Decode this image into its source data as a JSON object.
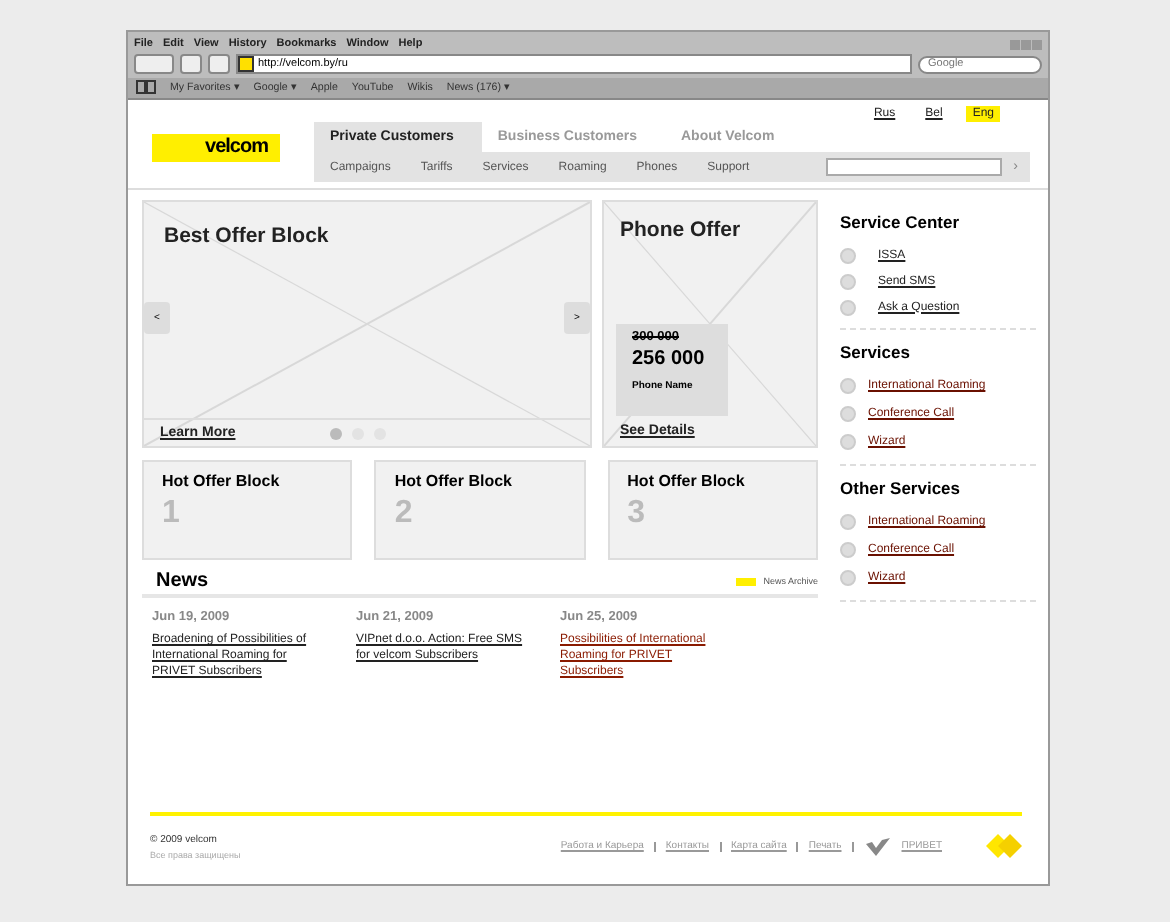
{
  "browser": {
    "menu": [
      "File",
      "Edit",
      "View",
      "History",
      "Bookmarks",
      "Window",
      "Help"
    ],
    "address": "http://velcom.by/ru",
    "search": {
      "placeholder": "Google"
    },
    "bookmarks": [
      "My Favorites ▾",
      "Google ▾",
      "Apple",
      "YouTube",
      "Wikis",
      "News (176) ▾"
    ]
  },
  "languages": [
    {
      "label": "Rus",
      "selected": false
    },
    {
      "label": "Bel",
      "selected": false
    },
    {
      "label": "Eng",
      "selected": true
    }
  ],
  "logo": "velcom",
  "tabs": [
    {
      "label": "Private Customers",
      "selected": true
    },
    {
      "label": "Business Customers",
      "selected": false
    },
    {
      "label": "About Velcom",
      "selected": false
    }
  ],
  "subnav": [
    "Campaigns",
    "Tariffs",
    "Services",
    "Roaming",
    "Phones",
    "Support"
  ],
  "subnav_search": {
    "button": "›"
  },
  "best_offer": {
    "title": "Best Offer Block",
    "link": "Learn More",
    "prev": "<",
    "next": ">",
    "dots": [
      {
        "selected": true
      },
      {
        "selected": false
      },
      {
        "selected": false
      }
    ]
  },
  "phone_offer": {
    "title": "Phone Offer",
    "old_price": "300 000",
    "price": "256 000",
    "name": "Phone Name",
    "link": "See Details"
  },
  "hot_offers": [
    {
      "title": "Hot Offer Block",
      "number": "1"
    },
    {
      "title": "Hot Offer Block",
      "number": "2"
    },
    {
      "title": "Hot Offer Block",
      "number": "3"
    }
  ],
  "news": {
    "title": "News",
    "archive": "News Archive",
    "items": [
      {
        "date": "Jun 19, 2009",
        "title": "Broadening of Possibilities of International Roaming for PRIVET Subscribers"
      },
      {
        "date": "Jun 21, 2009",
        "title": "VIPnet d.o.o. Action: Free SMS for velcom Subscribers"
      },
      {
        "date": "Jun 25, 2009",
        "title": "Possibilities of International Roaming for PRIVET Subscribers"
      }
    ]
  },
  "sidebar": [
    {
      "title": "Service Center",
      "links": [
        "ISSA",
        "Send SMS",
        "Ask a Question"
      ]
    },
    {
      "title": "Services",
      "links": [
        "International Roaming",
        "Conference Call",
        "Wizard"
      ]
    },
    {
      "title": "Other Services",
      "links": [
        "International Roaming",
        "Conference Call",
        "Wizard"
      ]
    }
  ],
  "footer": {
    "copyright": "© 2009 velcom",
    "rights": "Все права защищены",
    "links": [
      "Работа и Карьера",
      "Контакты",
      "Карта сайта",
      "Печать"
    ],
    "brand": "ПРИВЕТ"
  }
}
